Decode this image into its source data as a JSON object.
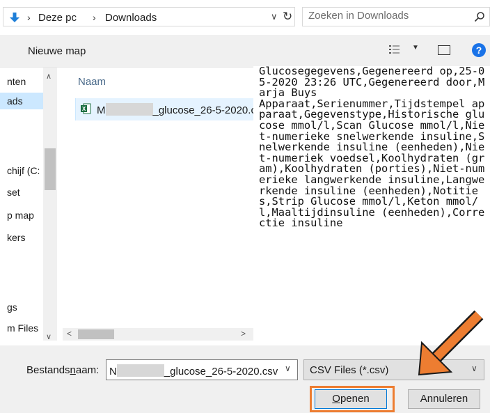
{
  "address": {
    "crumbs": [
      "Deze pc",
      "Downloads"
    ],
    "search_placeholder": "Zoeken in Downloads"
  },
  "toolbar": {
    "new_folder": "Nieuwe map"
  },
  "nav": {
    "items": [
      {
        "label": "nten",
        "selected": false
      },
      {
        "label": "ads",
        "selected": true
      },
      {
        "label": "chijf (C:",
        "selected": false
      },
      {
        "label": "set",
        "selected": false
      },
      {
        "label": "p map",
        "selected": false
      },
      {
        "label": "kers",
        "selected": false
      },
      {
        "label": "gs",
        "selected": false
      },
      {
        "label": "m Files",
        "selected": false
      }
    ]
  },
  "file_list": {
    "column_name": "Naam",
    "file": {
      "prefix": "M",
      "suffix": "_glucose_26-5-2020.c"
    }
  },
  "preview": {
    "text": "Glucosegegevens,Gegenereerd op,25-05-2020 23:26 UTC,Gegenereerd door,Marja Buys\nApparaat,Serienummer,Tijdstempel apparaat,Gegevenstype,Historische glucose mmol/l,Scan Glucose mmol/l,Niet-numerieke snelwerkende insuline,Snelwerkende insuline (eenheden),Niet-numeriek voedsel,Koolhydraten (gram),Koolhydraten (porties),Niet-numerieke langwerkende insuline,Langwerkende insuline (eenheden),Notities,Strip Glucose mmol/l,Keton mmol/l,Maaltijdinsuline (eenheden),Correctie insuline"
  },
  "bottom": {
    "filename_label_pre": "Bestands",
    "filename_label_u": "n",
    "filename_label_post": "aam:",
    "filename_prefix": "N",
    "filename_suffix": "_glucose_26-5-2020.csv",
    "filetype": "CSV Files (*.csv)",
    "open_pre": "",
    "open_u": "O",
    "open_post": "penen",
    "cancel": "Annuleren"
  },
  "colors": {
    "selection": "#cce8ff",
    "accent": "#0078d7",
    "annotation": "#ed7d31"
  }
}
